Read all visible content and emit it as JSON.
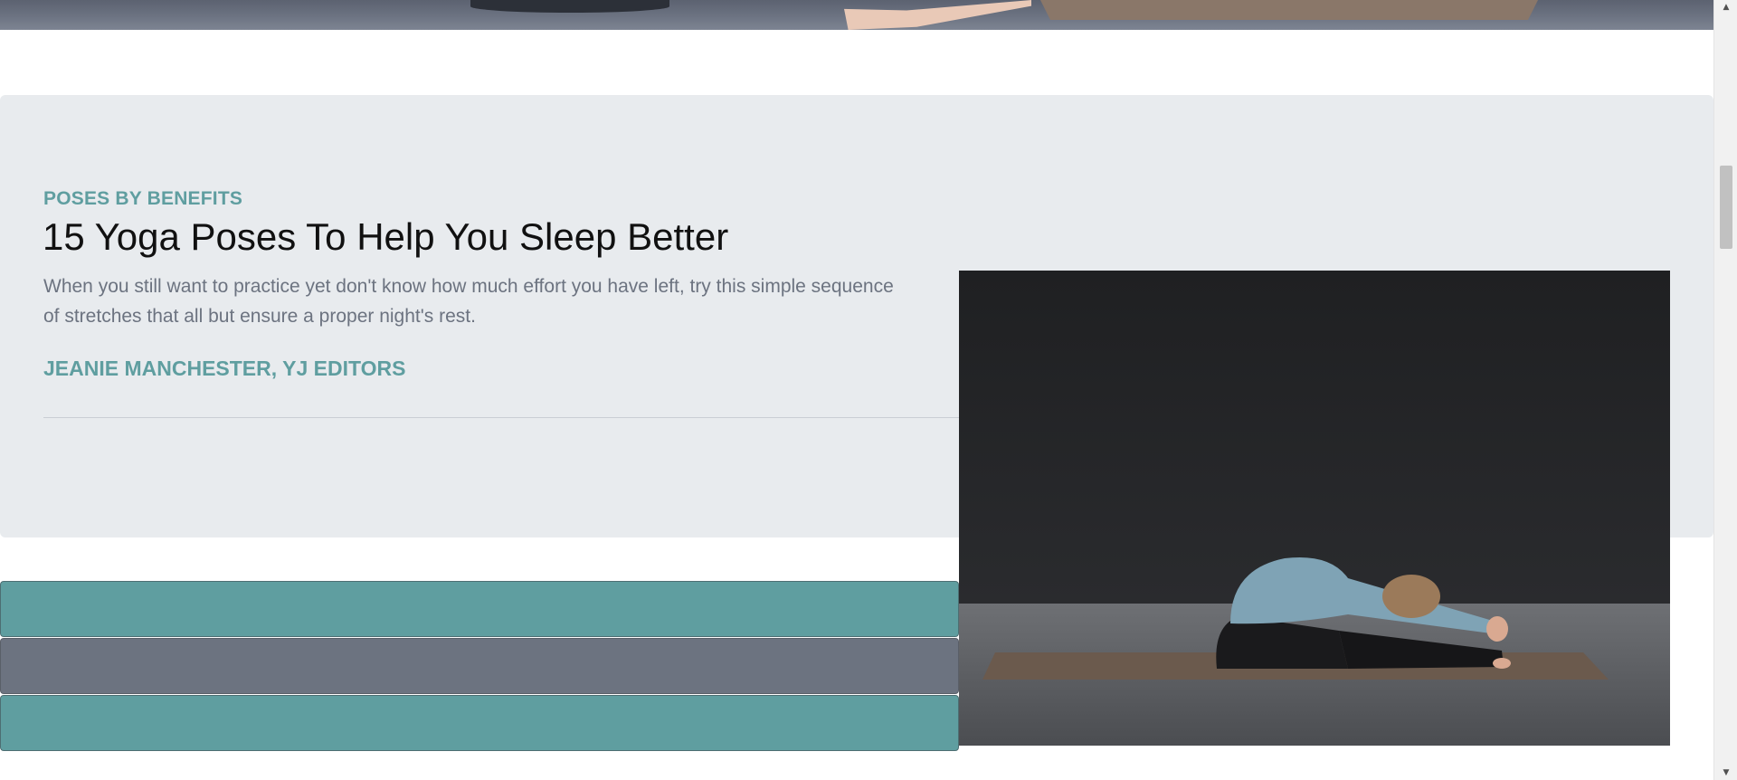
{
  "feature": {
    "category": "POSES BY BENEFITS",
    "title": "15 Yoga Poses To Help You Sleep Better",
    "description": "When you still want to practice yet don't know how much effort you have left, try this simple sequence of stretches that all but ensure a proper night's rest.",
    "author": "JEANIE MANCHESTER, YJ EDITORS",
    "image_subject": "woman-seated-forward-bend-photo"
  },
  "bars": [
    {
      "color": "#5f9ea0"
    },
    {
      "color": "#6c7380"
    },
    {
      "color": "#5f9ea0"
    }
  ],
  "scrollbar": {
    "up_arrow": "▲",
    "down_arrow": "▼"
  },
  "colors": {
    "accent": "#5f9ea0",
    "card_background": "#e8ebee",
    "muted_text": "#6c7380"
  }
}
